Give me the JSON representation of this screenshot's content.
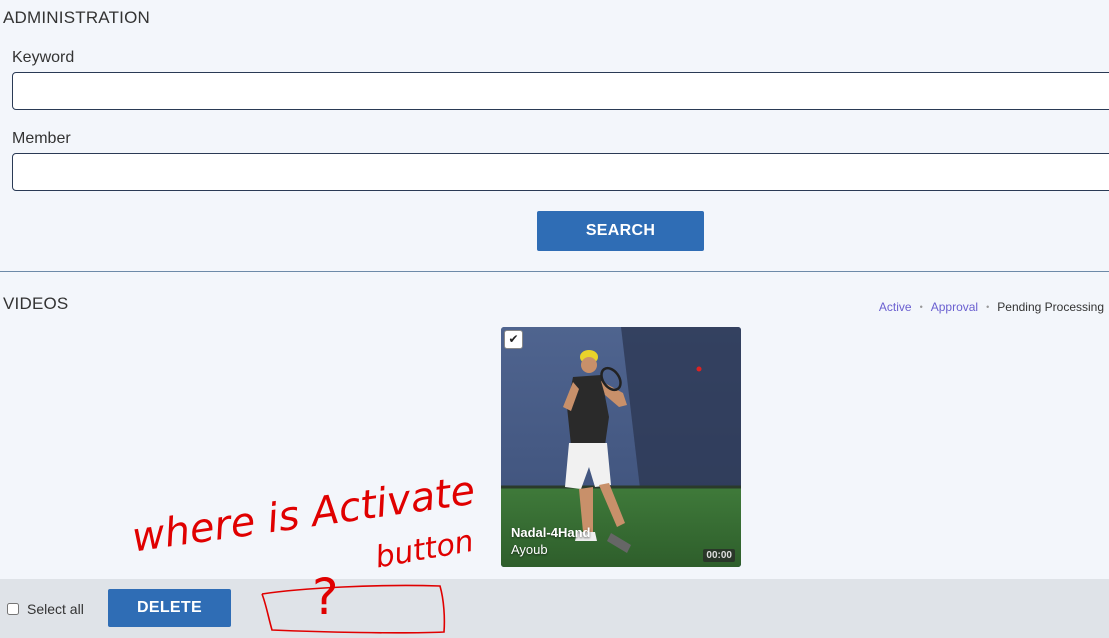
{
  "admin": {
    "title": "ADMINISTRATION",
    "keyword_label": "Keyword",
    "keyword_value": "",
    "member_label": "Member",
    "member_value": "",
    "search_label": "SEARCH"
  },
  "videos": {
    "title": "VIDEOS",
    "filters": [
      {
        "label": "Active"
      },
      {
        "label": "Approval"
      },
      {
        "label": "Pending Processing"
      }
    ],
    "items": [
      {
        "title": "Nadal-4Hand",
        "author": "Ayoub",
        "duration": "00:00",
        "checked": true
      }
    ]
  },
  "footer": {
    "select_all_label": "Select all",
    "delete_label": "DELETE"
  },
  "annotation": {
    "text_line1": "where is Activate",
    "text_line2": "button",
    "mark": "?",
    "color": "#e00000"
  },
  "colors": {
    "accent": "#2f6db5",
    "filter_link": "#6a5fd0",
    "background": "#f3f6fb",
    "bottom_bar": "#dfe3e8"
  }
}
